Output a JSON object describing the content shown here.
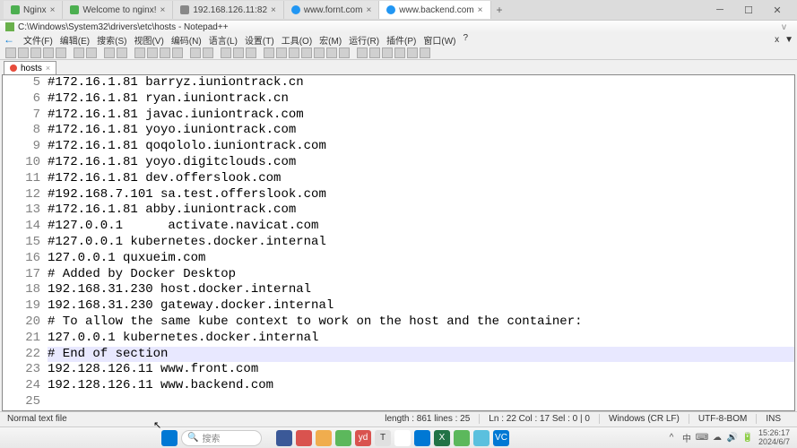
{
  "browser": {
    "tabs": [
      {
        "label": "Nginx",
        "ico": "green"
      },
      {
        "label": "Welcome to nginx!",
        "ico": "green"
      },
      {
        "label": "192.168.126.11:82",
        "ico": "generic"
      },
      {
        "label": "www.fornt.com",
        "ico": "blue"
      },
      {
        "label": "www.backend.com",
        "ico": "blue",
        "active": true
      }
    ],
    "add": "+"
  },
  "win_controls": {
    "min": "─",
    "max": "☐",
    "close": "✕"
  },
  "npp": {
    "title": "C:\\Windows\\System32\\drivers\\etc\\hosts - Notepad++",
    "right_caret": "v"
  },
  "menu": {
    "back": "←",
    "items": [
      "文件(F)",
      "编辑(E)",
      "搜索(S)",
      "视图(V)",
      "编码(N)",
      "语言(L)",
      "设置(T)",
      "工具(O)",
      "宏(M)",
      "运行(R)",
      "插件(P)",
      "窗口(W)",
      "?"
    ],
    "close_x": "x",
    "close_caret": "▼"
  },
  "file_tab": {
    "name": "hosts",
    "close": "×"
  },
  "lines": [
    {
      "n": 5,
      "t": "#172.16.1.81 barryz.iuniontrack.cn"
    },
    {
      "n": 6,
      "t": "#172.16.1.81 ryan.iuniontrack.cn"
    },
    {
      "n": 7,
      "t": "#172.16.1.81 javac.iuniontrack.com"
    },
    {
      "n": 8,
      "t": "#172.16.1.81 yoyo.iuniontrack.com"
    },
    {
      "n": 9,
      "t": "#172.16.1.81 qoqololo.iuniontrack.com"
    },
    {
      "n": 10,
      "t": "#172.16.1.81 yoyo.digitclouds.com"
    },
    {
      "n": 11,
      "t": "#172.16.1.81 dev.offerslook.com"
    },
    {
      "n": 12,
      "t": "#192.168.7.101 sa.test.offerslook.com"
    },
    {
      "n": 13,
      "t": "#172.16.1.81 abby.iuniontrack.com"
    },
    {
      "n": 14,
      "t": "#127.0.0.1      activate.navicat.com"
    },
    {
      "n": 15,
      "t": "#127.0.0.1 kubernetes.docker.internal"
    },
    {
      "n": 16,
      "t": "127.0.0.1 quxueim.com"
    },
    {
      "n": 17,
      "t": "# Added by Docker Desktop"
    },
    {
      "n": 18,
      "t": "192.168.31.230 host.docker.internal"
    },
    {
      "n": 19,
      "t": "192.168.31.230 gateway.docker.internal"
    },
    {
      "n": 20,
      "t": "# To allow the same kube context to work on the host and the container:"
    },
    {
      "n": 21,
      "t": "127.0.0.1 kubernetes.docker.internal"
    },
    {
      "n": 22,
      "t": "# End of section",
      "current": true
    },
    {
      "n": 23,
      "t": "192.128.126.11 www.front.com"
    },
    {
      "n": 24,
      "t": "192.128.126.11 www.backend.com"
    },
    {
      "n": 25,
      "t": ""
    }
  ],
  "status": {
    "type": "Normal text file",
    "length": "length : 861    lines : 25",
    "pos": "Ln : 22    Col : 17    Sel : 0 | 0",
    "eol": "Windows (CR LF)",
    "enc": "UTF-8-BOM",
    "mode": "INS"
  },
  "taskbar": {
    "search_placeholder": "搜索",
    "icons": [
      {
        "bg": "#3b5998",
        "ch": ""
      },
      {
        "bg": "#d9534f",
        "ch": ""
      },
      {
        "bg": "#f0ad4e",
        "ch": ""
      },
      {
        "bg": "#5cb85c",
        "ch": ""
      },
      {
        "bg": "#d9534f",
        "ch": "yd"
      },
      {
        "bg": "#e0e0e0",
        "ch": "T"
      },
      {
        "bg": "#ffffff",
        "ch": ""
      },
      {
        "bg": "#0078d4",
        "ch": ""
      },
      {
        "bg": "#217346",
        "ch": "X"
      },
      {
        "bg": "#5cb85c",
        "ch": ""
      },
      {
        "bg": "#5bc0de",
        "ch": ""
      },
      {
        "bg": "#0078d4",
        "ch": "VC"
      }
    ],
    "tray": [
      "^",
      "中",
      "⌨",
      "☁",
      "🔊",
      "🔋"
    ],
    "time": "15:26:17",
    "date": "2024/6/7"
  }
}
